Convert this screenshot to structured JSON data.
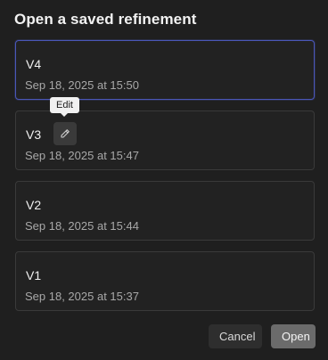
{
  "dialog": {
    "title": "Open a saved refinement"
  },
  "tooltip": {
    "text": "Edit"
  },
  "refinements": [
    {
      "name": "V4",
      "date": "Sep 18, 2025 at 15:50",
      "selected": true
    },
    {
      "name": "V3",
      "date": "Sep 18, 2025 at 15:47",
      "selected": false
    },
    {
      "name": "V2",
      "date": "Sep 18, 2025 at 15:44",
      "selected": false
    },
    {
      "name": "V1",
      "date": "Sep 18, 2025 at 15:37",
      "selected": false
    }
  ],
  "icons": {
    "edit": "pencil-icon"
  },
  "footer": {
    "cancel_label": "Cancel",
    "open_label": "Open"
  },
  "colors": {
    "background": "#1f1f1f",
    "selected_border": "#4a57b8",
    "card_border": "#3a3a3a"
  }
}
